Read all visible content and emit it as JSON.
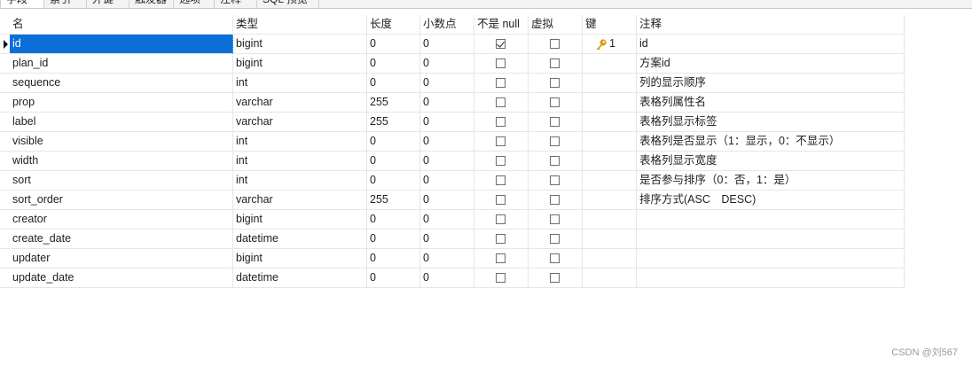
{
  "tabs": [
    "字段",
    "索引",
    "外键",
    "触发器",
    "选项",
    "注释",
    "SQL 预览"
  ],
  "columns": {
    "name": "名",
    "type": "类型",
    "length": "长度",
    "decimals": "小数点",
    "not_null": "不是 null",
    "virtual": "虚拟",
    "key": "键",
    "comment": "注释"
  },
  "rows": [
    {
      "name": "id",
      "type": "bigint",
      "length": "0",
      "decimals": "0",
      "not_null": true,
      "virtual": false,
      "key": "1",
      "comment": "id"
    },
    {
      "name": "plan_id",
      "type": "bigint",
      "length": "0",
      "decimals": "0",
      "not_null": false,
      "virtual": false,
      "key": "",
      "comment": "方案id"
    },
    {
      "name": "sequence",
      "type": "int",
      "length": "0",
      "decimals": "0",
      "not_null": false,
      "virtual": false,
      "key": "",
      "comment": "列的显示顺序"
    },
    {
      "name": "prop",
      "type": "varchar",
      "length": "255",
      "decimals": "0",
      "not_null": false,
      "virtual": false,
      "key": "",
      "comment": "表格列属性名"
    },
    {
      "name": "label",
      "type": "varchar",
      "length": "255",
      "decimals": "0",
      "not_null": false,
      "virtual": false,
      "key": "",
      "comment": "表格列显示标签"
    },
    {
      "name": "visible",
      "type": "int",
      "length": "0",
      "decimals": "0",
      "not_null": false,
      "virtual": false,
      "key": "",
      "comment": "表格列是否显示（1：显示，0：不显示）"
    },
    {
      "name": "width",
      "type": "int",
      "length": "0",
      "decimals": "0",
      "not_null": false,
      "virtual": false,
      "key": "",
      "comment": "表格列显示宽度"
    },
    {
      "name": "sort",
      "type": "int",
      "length": "0",
      "decimals": "0",
      "not_null": false,
      "virtual": false,
      "key": "",
      "comment": "是否参与排序（0：否，1：是）"
    },
    {
      "name": "sort_order",
      "type": "varchar",
      "length": "255",
      "decimals": "0",
      "not_null": false,
      "virtual": false,
      "key": "",
      "comment": "排序方式(ASC　DESC)"
    },
    {
      "name": "creator",
      "type": "bigint",
      "length": "0",
      "decimals": "0",
      "not_null": false,
      "virtual": false,
      "key": "",
      "comment": ""
    },
    {
      "name": "create_date",
      "type": "datetime",
      "length": "0",
      "decimals": "0",
      "not_null": false,
      "virtual": false,
      "key": "",
      "comment": ""
    },
    {
      "name": "updater",
      "type": "bigint",
      "length": "0",
      "decimals": "0",
      "not_null": false,
      "virtual": false,
      "key": "",
      "comment": ""
    },
    {
      "name": "update_date",
      "type": "datetime",
      "length": "0",
      "decimals": "0",
      "not_null": false,
      "virtual": false,
      "key": "",
      "comment": ""
    }
  ],
  "colors": {
    "selection": "#0a6fd6",
    "key_gold": "#d4a017"
  },
  "icons": {
    "key": "key-icon",
    "row_pointer": "row-pointer-icon"
  },
  "watermark": "CSDN @刘567"
}
